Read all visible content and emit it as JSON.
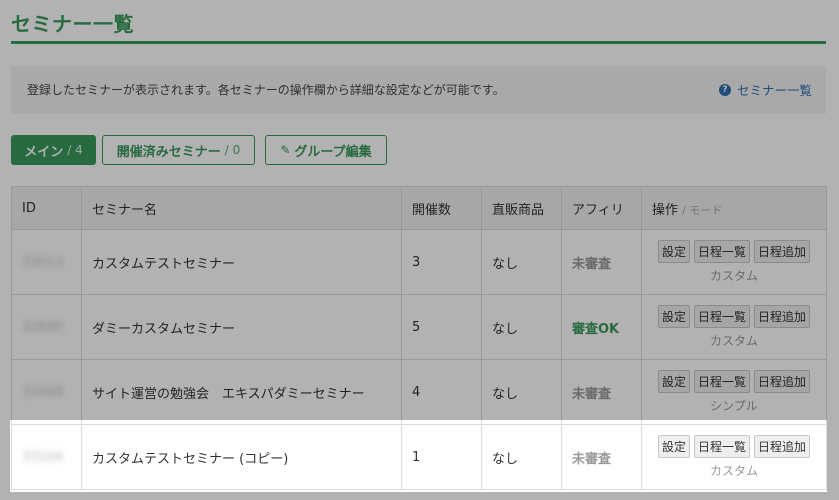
{
  "page": {
    "title": "セミナー一覧",
    "info_text": "登録したセミナーが表示されます。各セミナーの操作欄から詳細な設定などが可能です。",
    "help_icon": "?",
    "help_link": "セミナー一覧"
  },
  "tabs": [
    {
      "label": "メイン",
      "count": "/ 4",
      "active": true
    },
    {
      "label": "開催済みセミナー",
      "count": "/ 0",
      "active": false
    },
    {
      "label": "グループ編集",
      "icon": "pencil-icon",
      "active": false
    }
  ],
  "table": {
    "headers": {
      "id": "ID",
      "name": "セミナー名",
      "count": "開催数",
      "direct": "直販商品",
      "affiliate": "アフィリ",
      "ops": "操作",
      "ops_hint": "/ モード"
    },
    "op_buttons": {
      "settings": "設定",
      "schedule_list": "日程一覧",
      "schedule_add": "日程追加"
    },
    "rows": [
      {
        "id": "33013",
        "name": "カスタムテストセミナー",
        "count": "3",
        "direct": "なし",
        "affiliate": "未審査",
        "affiliate_ok": false,
        "mode": "カスタム"
      },
      {
        "id": "32690",
        "name": "ダミーカスタムセミナー",
        "count": "5",
        "direct": "なし",
        "affiliate": "審査OK",
        "affiliate_ok": true,
        "mode": "カスタム"
      },
      {
        "id": "32449",
        "name": "サイト運営の勉強会　エキスパダミーセミナー",
        "count": "4",
        "direct": "なし",
        "affiliate": "未審査",
        "affiliate_ok": false,
        "mode": "シンプル"
      },
      {
        "id": "33166",
        "name": "カスタムテストセミナー (コピー)",
        "count": "1",
        "direct": "なし",
        "affiliate": "未審査",
        "affiliate_ok": false,
        "mode": "カスタム"
      }
    ]
  },
  "colors": {
    "accent": "#3a9a5c",
    "link": "#2f6fb0",
    "overlay": "rgba(0,0,0,0.30)"
  }
}
